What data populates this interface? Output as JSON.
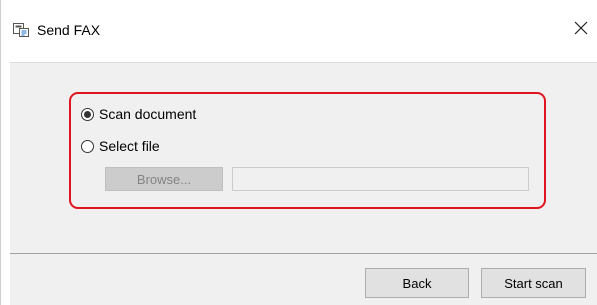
{
  "window": {
    "title": "Send FAX",
    "icon": "fax-icon",
    "close_icon": "close-icon"
  },
  "options": {
    "scan_document": {
      "label": "Scan document",
      "selected": true
    },
    "select_file": {
      "label": "Select file",
      "selected": false
    }
  },
  "file_picker": {
    "browse_label": "Browse...",
    "path_value": ""
  },
  "footer": {
    "back_label": "Back",
    "start_label": "Start scan"
  },
  "colors": {
    "highlight": "#e0141e",
    "panel_background": "#f0f0f0"
  }
}
